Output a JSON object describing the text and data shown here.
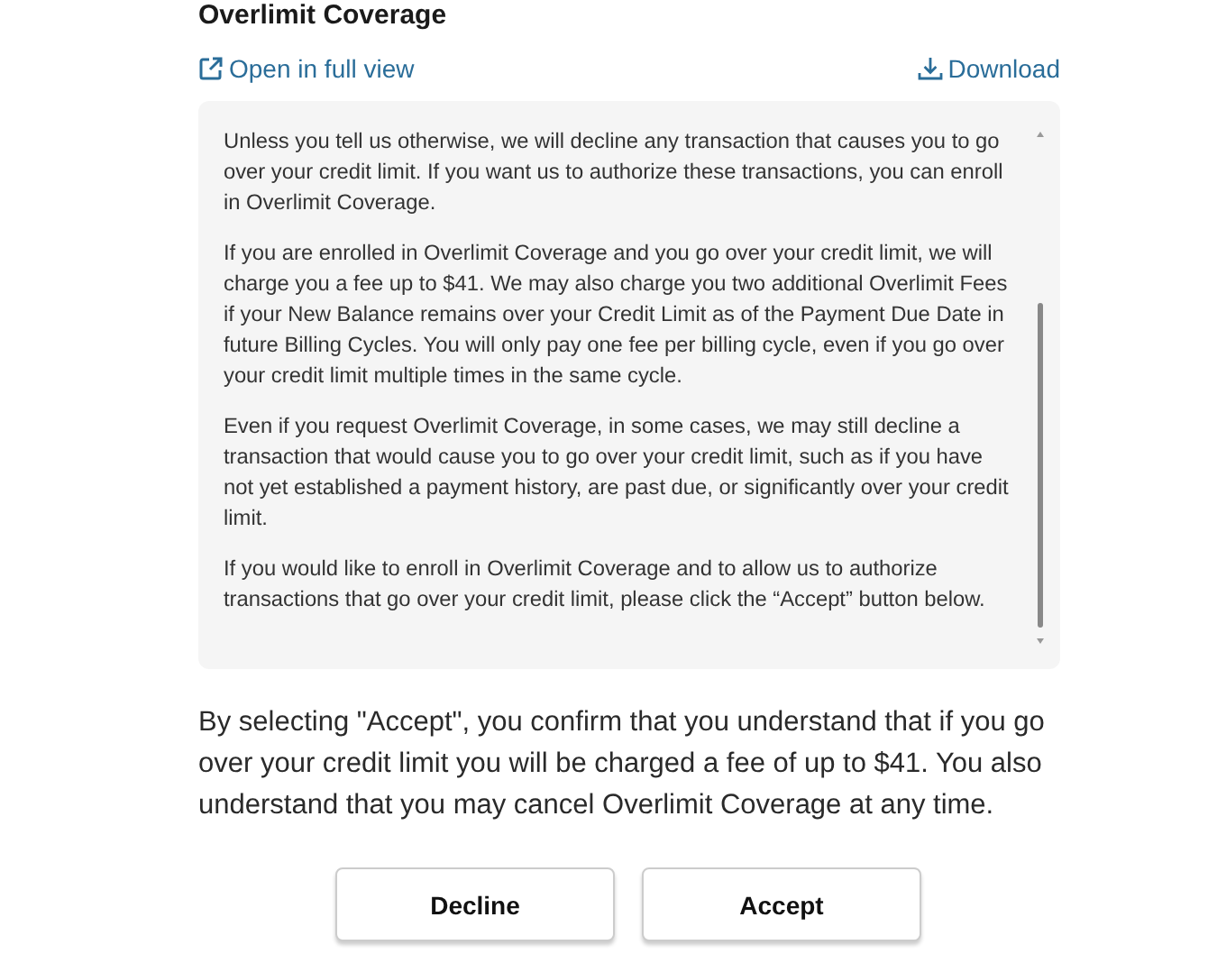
{
  "title": "Overlimit Coverage",
  "links": [
    {
      "kind": "open",
      "label": "Open in full view"
    },
    {
      "kind": "download",
      "label": "Download"
    }
  ],
  "terms": [
    "Unless you tell us otherwise, we will decline any transaction that causes you to go over your credit limit. If you want us to authorize these transactions, you can enroll in Overlimit Coverage.",
    "If you are enrolled in Overlimit Coverage and you go over your credit limit, we will charge you a fee up to $41. We may also charge you two additional Overlimit Fees if your New Balance remains over your Credit Limit as of the Payment Due Date in future Billing Cycles. You will only pay one fee per billing cycle, even if you go over your credit limit multiple times in the same cycle.",
    "Even if you request Overlimit Coverage, in some cases, we may still decline a transaction that would cause you to go over your credit limit, such as if you have not yet established a payment history, are past due, or significantly over your credit limit.",
    "If you would like to enroll in Overlimit Coverage and to allow us to authorize transactions that go over your credit limit, please click the “Accept” button below."
  ],
  "statement": "By selecting \"Accept\", you confirm that you understand that if you go over your credit limit you will be charged a fee of up to $41. You also understand that you may cancel Overlimit Coverage at any time.",
  "buttons": [
    "Decline",
    "Accept"
  ]
}
